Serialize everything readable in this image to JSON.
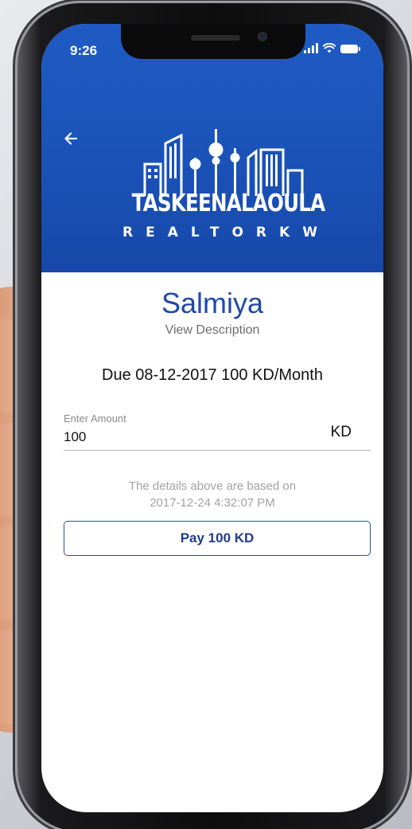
{
  "status_bar": {
    "time": "9:26"
  },
  "header": {
    "brand_name": "TASKEENALAOULA",
    "brand_sub": "REALTORKW",
    "accent_color": "#1a51b6"
  },
  "property": {
    "title": "Salmiya",
    "view_description_label": "View Description",
    "due_text": "Due 08-12-2017 100 KD/Month"
  },
  "amount_field": {
    "label": "Enter Amount",
    "value": "100",
    "currency": "KD"
  },
  "info": {
    "line1": "The details above are based on",
    "line2": "2017-12-24 4:32:07 PM"
  },
  "pay_button": {
    "label": "Pay 100 KD"
  },
  "icons": {
    "back": "back-arrow-icon",
    "signal": "signal-icon",
    "wifi": "wifi-icon",
    "battery": "battery-icon"
  }
}
